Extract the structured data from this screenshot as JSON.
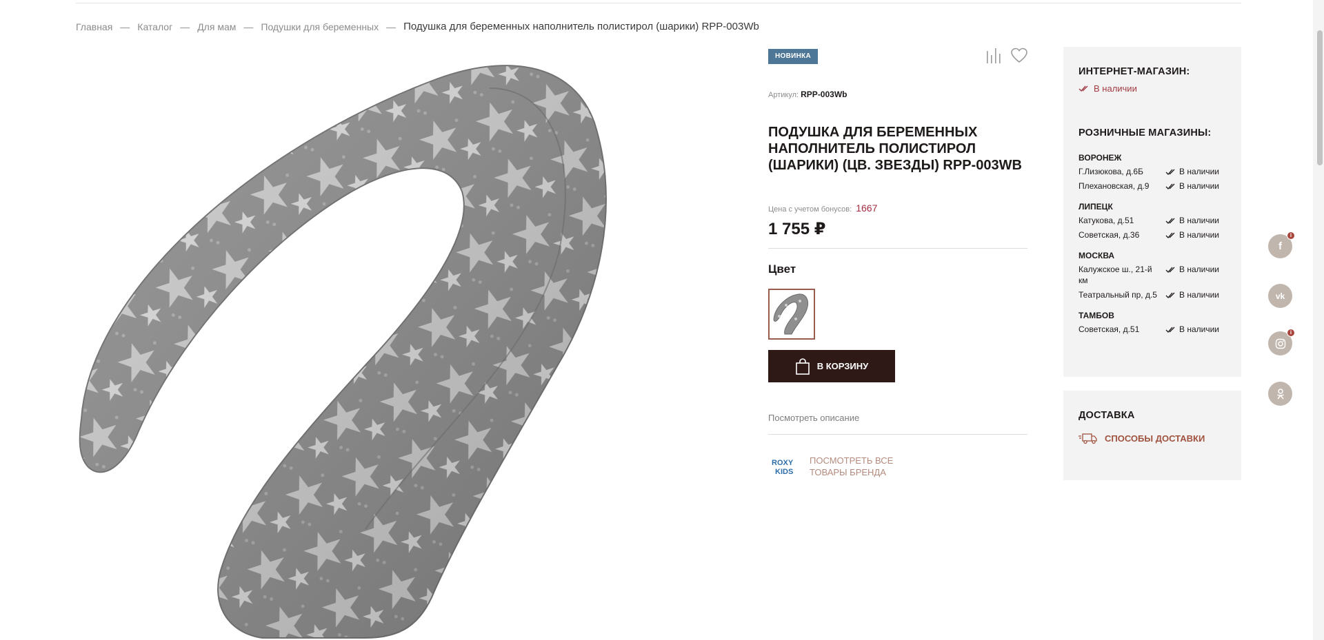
{
  "breadcrumb": {
    "items": [
      "Главная",
      "Каталог",
      "Для мам",
      "Подушки для беременных"
    ],
    "separator": "—",
    "current": "Подушка для беременных наполнитель полистирол (шарики) RPP-003Wb"
  },
  "product": {
    "badge": "НОВИНКА",
    "article_label": "Артикул:",
    "article_value": "RPP-003Wb",
    "title": "ПОДУШКА ДЛЯ БЕРЕМЕННЫХ НАПОЛНИТЕЛЬ ПОЛИСТИРОЛ (ШАРИКИ) (ЦВ. ЗВЕЗДЫ) RPP-003WB",
    "bonus_label": "Цена с учетом бонусов:",
    "bonus_value": "1667",
    "price": "1 755 ₽",
    "color_label": "Цвет",
    "cart_button": "В КОРЗИНУ",
    "description_link": "Посмотреть описание",
    "brand_logo_text": "ROXY KIDS",
    "brand_link": "ПОСМОТРЕТЬ ВСЕ ТОВАРЫ БРЕНДА",
    "icons": [
      "compare-icon",
      "heart-icon",
      "bag-icon"
    ]
  },
  "availability": {
    "online_title": "ИНТЕРНЕТ-МАГАЗИН:",
    "online_status": "В наличии",
    "retail_title": "РОЗНИЧНЫЕ МАГАЗИНЫ:",
    "cities": [
      {
        "name": "ВОРОНЕЖ",
        "stores": [
          {
            "address": "Г.Лизюкова, д.6Б",
            "status": "В наличии"
          },
          {
            "address": "Плехановская, д.9",
            "status": "В наличии"
          }
        ]
      },
      {
        "name": "ЛИПЕЦК",
        "stores": [
          {
            "address": "Катукова, д.51",
            "status": "В наличии"
          },
          {
            "address": "Советская, д.36",
            "status": "В наличии"
          }
        ]
      },
      {
        "name": "МОСКВА",
        "stores": [
          {
            "address": "Калужское ш., 21-й км",
            "status": "В наличии"
          },
          {
            "address": "Театральный пр, д.5",
            "status": "В наличии"
          }
        ]
      },
      {
        "name": "ТАМБОВ",
        "stores": [
          {
            "address": "Советская, д.51",
            "status": "В наличии"
          }
        ]
      }
    ]
  },
  "delivery": {
    "title": "ДОСТАВКА",
    "link": "СПОСОБЫ ДОСТАВКИ"
  },
  "social": [
    {
      "icon": "facebook-icon",
      "glyph": "f",
      "notification": "i"
    },
    {
      "icon": "vk-icon",
      "glyph": "vk",
      "notification": ""
    },
    {
      "icon": "instagram-icon",
      "glyph": "",
      "notification": "i"
    },
    {
      "icon": "odnoklassniki-icon",
      "glyph": "",
      "notification": ""
    }
  ],
  "colors": {
    "badge": "#4d7697",
    "bonus": "#a42b40",
    "cart_button": "#2e1917",
    "in_stock": "#a03a42",
    "brand_link": "#b48a7d",
    "delivery_link": "#a0523e",
    "panel_bg": "#f3f3f3",
    "social_bg": "#c1b6ad"
  }
}
